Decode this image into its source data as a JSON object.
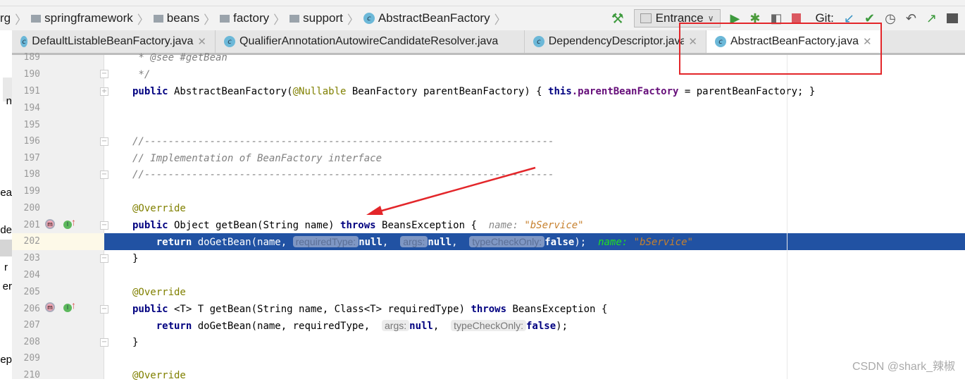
{
  "breadcrumb": [
    "rg",
    "springframework",
    "beans",
    "factory",
    "support",
    "AbstractBeanFactory"
  ],
  "toolbar": {
    "run_config": "Entrance",
    "git_label": "Git:",
    "icons": [
      "build-hammer-icon",
      "run-icon",
      "debug-icon",
      "coverage-icon",
      "stop-icon",
      "git-update-icon",
      "git-commit-icon",
      "history-icon",
      "revert-icon",
      "push-icon",
      "project-structure-icon"
    ]
  },
  "tabs": [
    {
      "label": "DefaultListableBeanFactory.java",
      "active": false
    },
    {
      "label": "QualifierAnnotationAutowireCandidateResolver.java",
      "active": false
    },
    {
      "label": "DependencyDescriptor.java",
      "active": false
    },
    {
      "label": "AbstractBeanFactory.java",
      "active": true
    }
  ],
  "left_fragments": [
    "n",
    "ea",
    "de",
    "r",
    "er",
    "ep"
  ],
  "lines": {
    "l189": "189",
    "l190": "190",
    "l191": "191",
    "l194": "194",
    "l195": "195",
    "l196": "196",
    "l197": "197",
    "l198": "198",
    "l199": "199",
    "l200": "200",
    "l201": "201",
    "l202": "202",
    "l203": "203",
    "l204": "204",
    "l205": "205",
    "l206": "206",
    "l207": "207",
    "l208": "208",
    "l209": "209",
    "l210": "210"
  },
  "code": {
    "c189": " * @see #getBean",
    "c190": " */",
    "c191a": "public",
    "c191b": " AbstractBeanFactory(",
    "c191c": "@Nullable",
    "c191d": " BeanFactory parentBeanFactory) { ",
    "c191e": "this",
    "c191f": ".parentBeanFactory",
    "c191g": " = parentBeanFactory; }",
    "c196": "//---------------------------------------------------------------------",
    "c197": "// Implementation of BeanFactory interface",
    "c198": "//---------------------------------------------------------------------",
    "c200": "@Override",
    "c201a": "public",
    "c201b": " Object getBean(String name) ",
    "c201c": "throws",
    "c201d": " BeansException {  ",
    "c201e": "name: ",
    "c201f": "\"bService\"",
    "c202a": "    return",
    "c202b": " doGetBean(name, ",
    "c202h1": "requiredType:",
    "c202n1": "null",
    "c202c": ",  ",
    "c202h2": "args:",
    "c202n2": "null",
    "c202d": ",  ",
    "c202h3": "typeCheckOnly:",
    "c202n3": "false",
    "c202e": ");  ",
    "c202f": "name: ",
    "c202g": "\"bService\"",
    "c203": "}",
    "c205": "@Override",
    "c206a": "public",
    "c206b": " <T> T getBean(String name, Class<T> requiredType) ",
    "c206c": "throws",
    "c206d": " BeansException {",
    "c207a": "    return",
    "c207b": " doGetBean(name, requiredType,  ",
    "c207h1": "args:",
    "c207n1": "null",
    "c207c": ",  ",
    "c207h2": "typeCheckOnly:",
    "c207n2": "false",
    "c207d": ");",
    "c208": "}",
    "c210": "@Override"
  },
  "watermark": "CSDN @shark_辣椒",
  "colors": {
    "selection": "#2152a3",
    "annotation_red": "#e3262a",
    "keyword": "#000080"
  }
}
